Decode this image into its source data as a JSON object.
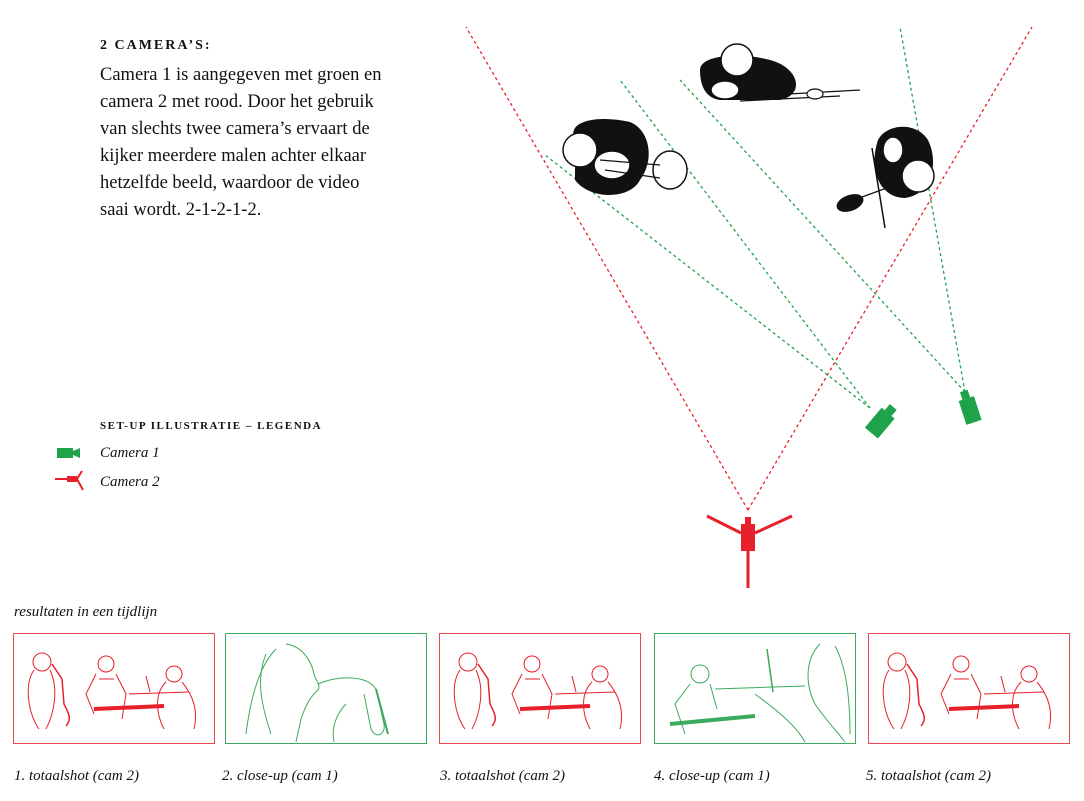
{
  "text": {
    "heading": "2 camera’s:",
    "body": "Camera 1 is aangegeven met groen en camera 2 met rood. Door het gebruik van slechts twee camera’s ervaart de kijker meerdere malen achter elkaar hetzelfde beeld, waardoor de video saai wordt. 2-1-2-1-2."
  },
  "legend": {
    "title": "set-up illustratie – legenda",
    "camera1": "Camera 1",
    "camera2": "Camera 2"
  },
  "timeline": {
    "title": "resultaten in een tijdlijn",
    "frames": [
      {
        "caption": "1. totaalshot (cam 2)",
        "camera": "cam2",
        "shot": "totaalshot"
      },
      {
        "caption": "2. close-up (cam 1)",
        "camera": "cam1",
        "shot": "close-up"
      },
      {
        "caption": "3. totaalshot (cam 2)",
        "camera": "cam2",
        "shot": "totaalshot"
      },
      {
        "caption": "4. close-up (cam 1)",
        "camera": "cam1",
        "shot": "close-up"
      },
      {
        "caption": "5. totaalshot (cam 2)",
        "camera": "cam2",
        "shot": "totaalshot"
      }
    ]
  },
  "colors": {
    "camera1": "#1fa34a",
    "camera2": "#e8202a"
  }
}
